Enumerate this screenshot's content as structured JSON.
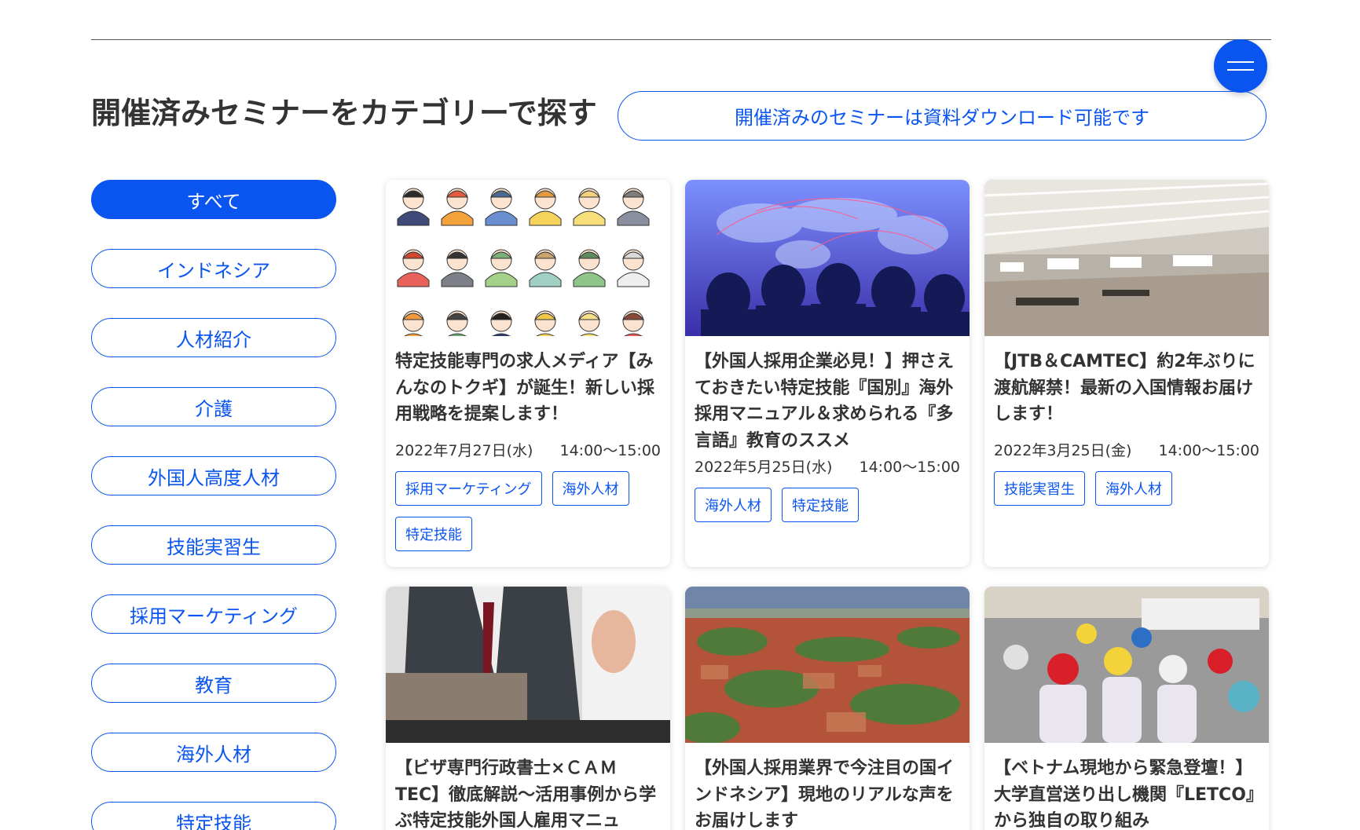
{
  "header": {
    "heading": "開催済みセミナーをカテゴリーで探す",
    "notice": "開催済みのセミナーは資料ダウンロード可能です",
    "menu_icon": "hamburger-icon"
  },
  "categories": [
    {
      "label": "すべて",
      "active": true
    },
    {
      "label": "インドネシア"
    },
    {
      "label": "人材紹介"
    },
    {
      "label": "介護"
    },
    {
      "label": "外国人高度人材"
    },
    {
      "label": "技能実習生"
    },
    {
      "label": "採用マーケティング"
    },
    {
      "label": "教育"
    },
    {
      "label": "海外人材"
    },
    {
      "label": "特定技能"
    }
  ],
  "seminars": [
    {
      "title": "特定技能専門の求人メディア【みんなのトクギ】が誕生！新しい採用戦略を提案します！",
      "date": "2022年7月27日(水)",
      "time": "14:00〜15:00",
      "tags": [
        "採用マーケティング",
        "海外人材",
        "特定技能"
      ]
    },
    {
      "title": "【外国人採用企業必見！】押さえておきたい特定技能『国別』海外採用マニュアル＆求められる『多言語』教育のススメ",
      "date": "2022年5月25日(水)",
      "time": "14:00〜15:00",
      "tags": [
        "海外人材",
        "特定技能"
      ]
    },
    {
      "title": "【JTB＆CAMTEC】約2年ぶりに渡航解禁！最新の入国情報お届けします！",
      "date": "2022年3月25日(金)",
      "time": "14:00〜15:00",
      "tags": [
        "技能実習生",
        "海外人材"
      ]
    },
    {
      "title": "【ビザ専門行政書士×ＣＡＭTEC】徹底解説〜活用事例から学ぶ特定技能外国人雇用マニュ"
    },
    {
      "title": "【外国人採用業界で今注目の国インドネシア】現地のリアルな声をお届けします"
    },
    {
      "title": "【ベトナム現地から緊急登壇！】大学直営送り出し機関『LETCO』から独自の取り組み"
    }
  ],
  "colors": {
    "accent": "#0a55f0",
    "text": "#333333"
  }
}
